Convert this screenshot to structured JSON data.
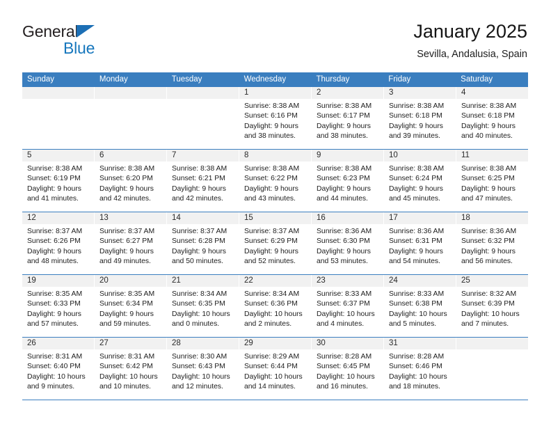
{
  "brand": {
    "name_part1": "General",
    "name_part2": "Blue",
    "triangle_color": "#1c6fb5",
    "blue_color": "#1777bd"
  },
  "header": {
    "title": "January 2025",
    "subtitle": "Sevilla, Andalusia, Spain"
  },
  "theme": {
    "header_blue": "#3a7ebf",
    "day_strip_gray": "#f1f1f1",
    "rule_blue": "#3a7ebf"
  },
  "weekday_headers": [
    "Sunday",
    "Monday",
    "Tuesday",
    "Wednesday",
    "Thursday",
    "Friday",
    "Saturday"
  ],
  "labels": {
    "sunrise_prefix": "Sunrise:",
    "sunset_prefix": "Sunset:",
    "daylight_prefix": "Daylight:"
  },
  "weeks": [
    [
      {
        "day": "",
        "empty": true,
        "line1": "",
        "line2": "",
        "line3": "",
        "line4": ""
      },
      {
        "day": "",
        "empty": true,
        "line1": "",
        "line2": "",
        "line3": "",
        "line4": ""
      },
      {
        "day": "",
        "empty": true,
        "line1": "",
        "line2": "",
        "line3": "",
        "line4": ""
      },
      {
        "day": "1",
        "empty": false,
        "line1": "Sunrise: 8:38 AM",
        "line2": "Sunset: 6:16 PM",
        "line3": "Daylight: 9 hours",
        "line4": "and 38 minutes."
      },
      {
        "day": "2",
        "empty": false,
        "line1": "Sunrise: 8:38 AM",
        "line2": "Sunset: 6:17 PM",
        "line3": "Daylight: 9 hours",
        "line4": "and 38 minutes."
      },
      {
        "day": "3",
        "empty": false,
        "line1": "Sunrise: 8:38 AM",
        "line2": "Sunset: 6:18 PM",
        "line3": "Daylight: 9 hours",
        "line4": "and 39 minutes."
      },
      {
        "day": "4",
        "empty": false,
        "line1": "Sunrise: 8:38 AM",
        "line2": "Sunset: 6:18 PM",
        "line3": "Daylight: 9 hours",
        "line4": "and 40 minutes."
      }
    ],
    [
      {
        "day": "5",
        "empty": false,
        "line1": "Sunrise: 8:38 AM",
        "line2": "Sunset: 6:19 PM",
        "line3": "Daylight: 9 hours",
        "line4": "and 41 minutes."
      },
      {
        "day": "6",
        "empty": false,
        "line1": "Sunrise: 8:38 AM",
        "line2": "Sunset: 6:20 PM",
        "line3": "Daylight: 9 hours",
        "line4": "and 42 minutes."
      },
      {
        "day": "7",
        "empty": false,
        "line1": "Sunrise: 8:38 AM",
        "line2": "Sunset: 6:21 PM",
        "line3": "Daylight: 9 hours",
        "line4": "and 42 minutes."
      },
      {
        "day": "8",
        "empty": false,
        "line1": "Sunrise: 8:38 AM",
        "line2": "Sunset: 6:22 PM",
        "line3": "Daylight: 9 hours",
        "line4": "and 43 minutes."
      },
      {
        "day": "9",
        "empty": false,
        "line1": "Sunrise: 8:38 AM",
        "line2": "Sunset: 6:23 PM",
        "line3": "Daylight: 9 hours",
        "line4": "and 44 minutes."
      },
      {
        "day": "10",
        "empty": false,
        "line1": "Sunrise: 8:38 AM",
        "line2": "Sunset: 6:24 PM",
        "line3": "Daylight: 9 hours",
        "line4": "and 45 minutes."
      },
      {
        "day": "11",
        "empty": false,
        "line1": "Sunrise: 8:38 AM",
        "line2": "Sunset: 6:25 PM",
        "line3": "Daylight: 9 hours",
        "line4": "and 47 minutes."
      }
    ],
    [
      {
        "day": "12",
        "empty": false,
        "line1": "Sunrise: 8:37 AM",
        "line2": "Sunset: 6:26 PM",
        "line3": "Daylight: 9 hours",
        "line4": "and 48 minutes."
      },
      {
        "day": "13",
        "empty": false,
        "line1": "Sunrise: 8:37 AM",
        "line2": "Sunset: 6:27 PM",
        "line3": "Daylight: 9 hours",
        "line4": "and 49 minutes."
      },
      {
        "day": "14",
        "empty": false,
        "line1": "Sunrise: 8:37 AM",
        "line2": "Sunset: 6:28 PM",
        "line3": "Daylight: 9 hours",
        "line4": "and 50 minutes."
      },
      {
        "day": "15",
        "empty": false,
        "line1": "Sunrise: 8:37 AM",
        "line2": "Sunset: 6:29 PM",
        "line3": "Daylight: 9 hours",
        "line4": "and 52 minutes."
      },
      {
        "day": "16",
        "empty": false,
        "line1": "Sunrise: 8:36 AM",
        "line2": "Sunset: 6:30 PM",
        "line3": "Daylight: 9 hours",
        "line4": "and 53 minutes."
      },
      {
        "day": "17",
        "empty": false,
        "line1": "Sunrise: 8:36 AM",
        "line2": "Sunset: 6:31 PM",
        "line3": "Daylight: 9 hours",
        "line4": "and 54 minutes."
      },
      {
        "day": "18",
        "empty": false,
        "line1": "Sunrise: 8:36 AM",
        "line2": "Sunset: 6:32 PM",
        "line3": "Daylight: 9 hours",
        "line4": "and 56 minutes."
      }
    ],
    [
      {
        "day": "19",
        "empty": false,
        "line1": "Sunrise: 8:35 AM",
        "line2": "Sunset: 6:33 PM",
        "line3": "Daylight: 9 hours",
        "line4": "and 57 minutes."
      },
      {
        "day": "20",
        "empty": false,
        "line1": "Sunrise: 8:35 AM",
        "line2": "Sunset: 6:34 PM",
        "line3": "Daylight: 9 hours",
        "line4": "and 59 minutes."
      },
      {
        "day": "21",
        "empty": false,
        "line1": "Sunrise: 8:34 AM",
        "line2": "Sunset: 6:35 PM",
        "line3": "Daylight: 10 hours",
        "line4": "and 0 minutes."
      },
      {
        "day": "22",
        "empty": false,
        "line1": "Sunrise: 8:34 AM",
        "line2": "Sunset: 6:36 PM",
        "line3": "Daylight: 10 hours",
        "line4": "and 2 minutes."
      },
      {
        "day": "23",
        "empty": false,
        "line1": "Sunrise: 8:33 AM",
        "line2": "Sunset: 6:37 PM",
        "line3": "Daylight: 10 hours",
        "line4": "and 4 minutes."
      },
      {
        "day": "24",
        "empty": false,
        "line1": "Sunrise: 8:33 AM",
        "line2": "Sunset: 6:38 PM",
        "line3": "Daylight: 10 hours",
        "line4": "and 5 minutes."
      },
      {
        "day": "25",
        "empty": false,
        "line1": "Sunrise: 8:32 AM",
        "line2": "Sunset: 6:39 PM",
        "line3": "Daylight: 10 hours",
        "line4": "and 7 minutes."
      }
    ],
    [
      {
        "day": "26",
        "empty": false,
        "line1": "Sunrise: 8:31 AM",
        "line2": "Sunset: 6:40 PM",
        "line3": "Daylight: 10 hours",
        "line4": "and 9 minutes."
      },
      {
        "day": "27",
        "empty": false,
        "line1": "Sunrise: 8:31 AM",
        "line2": "Sunset: 6:42 PM",
        "line3": "Daylight: 10 hours",
        "line4": "and 10 minutes."
      },
      {
        "day": "28",
        "empty": false,
        "line1": "Sunrise: 8:30 AM",
        "line2": "Sunset: 6:43 PM",
        "line3": "Daylight: 10 hours",
        "line4": "and 12 minutes."
      },
      {
        "day": "29",
        "empty": false,
        "line1": "Sunrise: 8:29 AM",
        "line2": "Sunset: 6:44 PM",
        "line3": "Daylight: 10 hours",
        "line4": "and 14 minutes."
      },
      {
        "day": "30",
        "empty": false,
        "line1": "Sunrise: 8:28 AM",
        "line2": "Sunset: 6:45 PM",
        "line3": "Daylight: 10 hours",
        "line4": "and 16 minutes."
      },
      {
        "day": "31",
        "empty": false,
        "line1": "Sunrise: 8:28 AM",
        "line2": "Sunset: 6:46 PM",
        "line3": "Daylight: 10 hours",
        "line4": "and 18 minutes."
      },
      {
        "day": "",
        "empty": true,
        "line1": "",
        "line2": "",
        "line3": "",
        "line4": ""
      }
    ]
  ]
}
